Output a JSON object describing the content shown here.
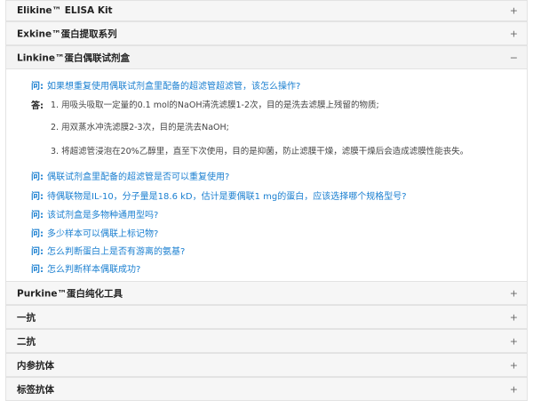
{
  "accordion": {
    "sections": [
      {
        "title": "Elikine™ ELISA Kit",
        "toggle": "+"
      },
      {
        "title": "Exkine™蛋白提取系列",
        "toggle": "+"
      },
      {
        "title": "Linkine™蛋白偶联试剂盒",
        "toggle": "−"
      },
      {
        "title": "Purkine™蛋白纯化工具",
        "toggle": "+"
      },
      {
        "title": "一抗",
        "toggle": "+"
      },
      {
        "title": "二抗",
        "toggle": "+"
      },
      {
        "title": "内参抗体",
        "toggle": "+"
      },
      {
        "title": "标签抗体",
        "toggle": "+"
      }
    ]
  },
  "faq": {
    "question_label": "问:",
    "answer_label": "答:",
    "first_question": "如果想重复使用偶联试剂盒里配备的超滤管超滤管，该怎么操作?",
    "answer_lines": [
      "1. 用吸头吸取一定量的0.1 mol的NaOH清洗滤膜1-2次，目的是洗去滤膜上残留的物质;",
      "2. 用双蒸水冲洗滤膜2-3次，目的是洗去NaOH;",
      "3. 将超滤管浸泡在20%乙醇里，直至下次使用，目的是抑菌，防止滤膜干燥，滤膜干燥后会造成滤膜性能丧失。"
    ],
    "other_questions": [
      "偶联试剂盒里配备的超滤管是否可以重复使用?",
      "待偶联物是IL-10，分子量是18.6 kD，估计是要偶联1 mg的蛋白，应该选择哪个规格型号?",
      "该试剂盒是多物种通用型吗?",
      "多少样本可以偶联上标记物?",
      "怎么判断蛋白上是否有游离的氨基?",
      "怎么判断样本偶联成功?"
    ]
  }
}
